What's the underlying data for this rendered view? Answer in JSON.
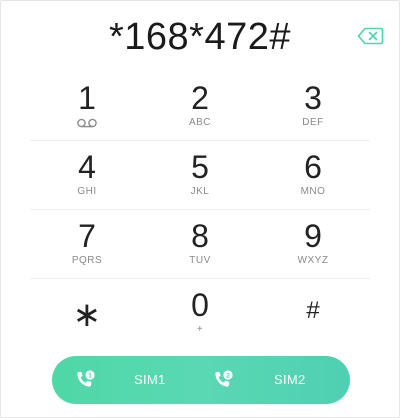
{
  "display": {
    "number": "*168*472#"
  },
  "icons": {
    "backspace": "backspace-icon",
    "voicemail": "voicemail-icon",
    "call": "phone-call-icon"
  },
  "keypad": {
    "rows": [
      [
        {
          "digit": "1",
          "sub": ""
        },
        {
          "digit": "2",
          "sub": "ABC"
        },
        {
          "digit": "3",
          "sub": "DEF"
        }
      ],
      [
        {
          "digit": "4",
          "sub": "GHI"
        },
        {
          "digit": "5",
          "sub": "JKL"
        },
        {
          "digit": "6",
          "sub": "MNO"
        }
      ],
      [
        {
          "digit": "7",
          "sub": "PQRS"
        },
        {
          "digit": "8",
          "sub": "TUV"
        },
        {
          "digit": "9",
          "sub": "WXYZ"
        }
      ],
      [
        {
          "digit": "∗",
          "sub": ""
        },
        {
          "digit": "0",
          "sub": "+"
        },
        {
          "digit": "#",
          "sub": ""
        }
      ]
    ]
  },
  "call_bar": {
    "sim1_label": "SIM1",
    "sim2_label": "SIM2",
    "sim1_badge": "1",
    "sim2_badge": "2"
  },
  "colors": {
    "accent": "#4fd6a8",
    "text": "#222222",
    "subtext": "#8a8a8a"
  }
}
